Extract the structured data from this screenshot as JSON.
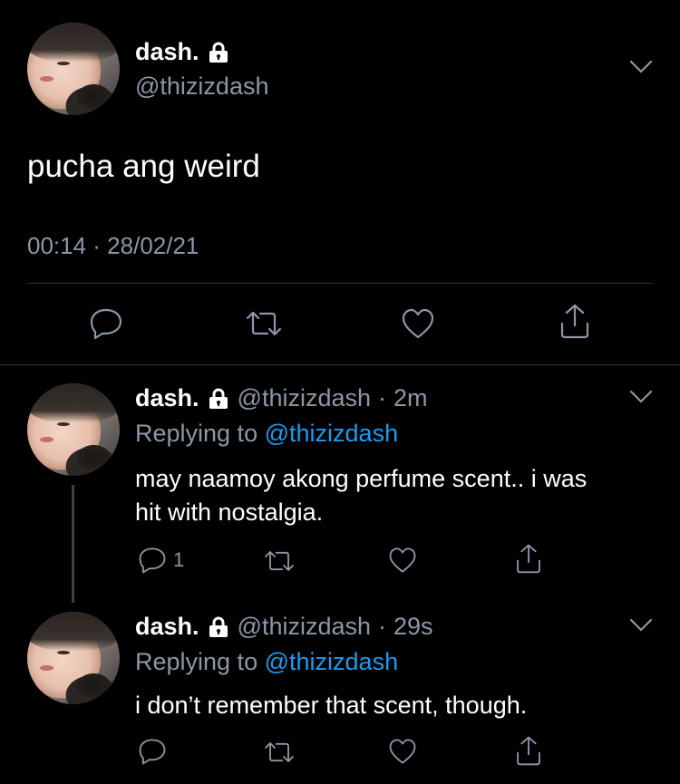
{
  "main_tweet": {
    "name": "dash.",
    "handle": "@thizizdash",
    "text": "pucha ang weird",
    "timestamp": "00:14 · 28/02/21",
    "icons": [
      "lock-icon",
      "chevron-down-icon",
      "reply-icon",
      "retweet-icon",
      "like-icon",
      "share-icon"
    ]
  },
  "replies": [
    {
      "name": "dash.",
      "handle": "@thizizdash",
      "time_sep": "·",
      "time": "2m",
      "replying_prefix": "Replying to",
      "replying_to": "@thizizdash",
      "text_line1": "may naamoy akong perfume scent.. i was",
      "text_line2": "hit with nostalgia.",
      "reply_count": "1"
    },
    {
      "name": "dash.",
      "handle": "@thizizdash",
      "time_sep": "·",
      "time": "29s",
      "replying_prefix": "Replying to",
      "replying_to": "@thizizdash",
      "text_line1": "i don’t remember that scent, though."
    }
  ],
  "colors": {
    "background": "#000000",
    "text": "#ffffff",
    "muted": "#8b98a5",
    "link": "#1d9bf0",
    "divider": "#2f3336"
  }
}
